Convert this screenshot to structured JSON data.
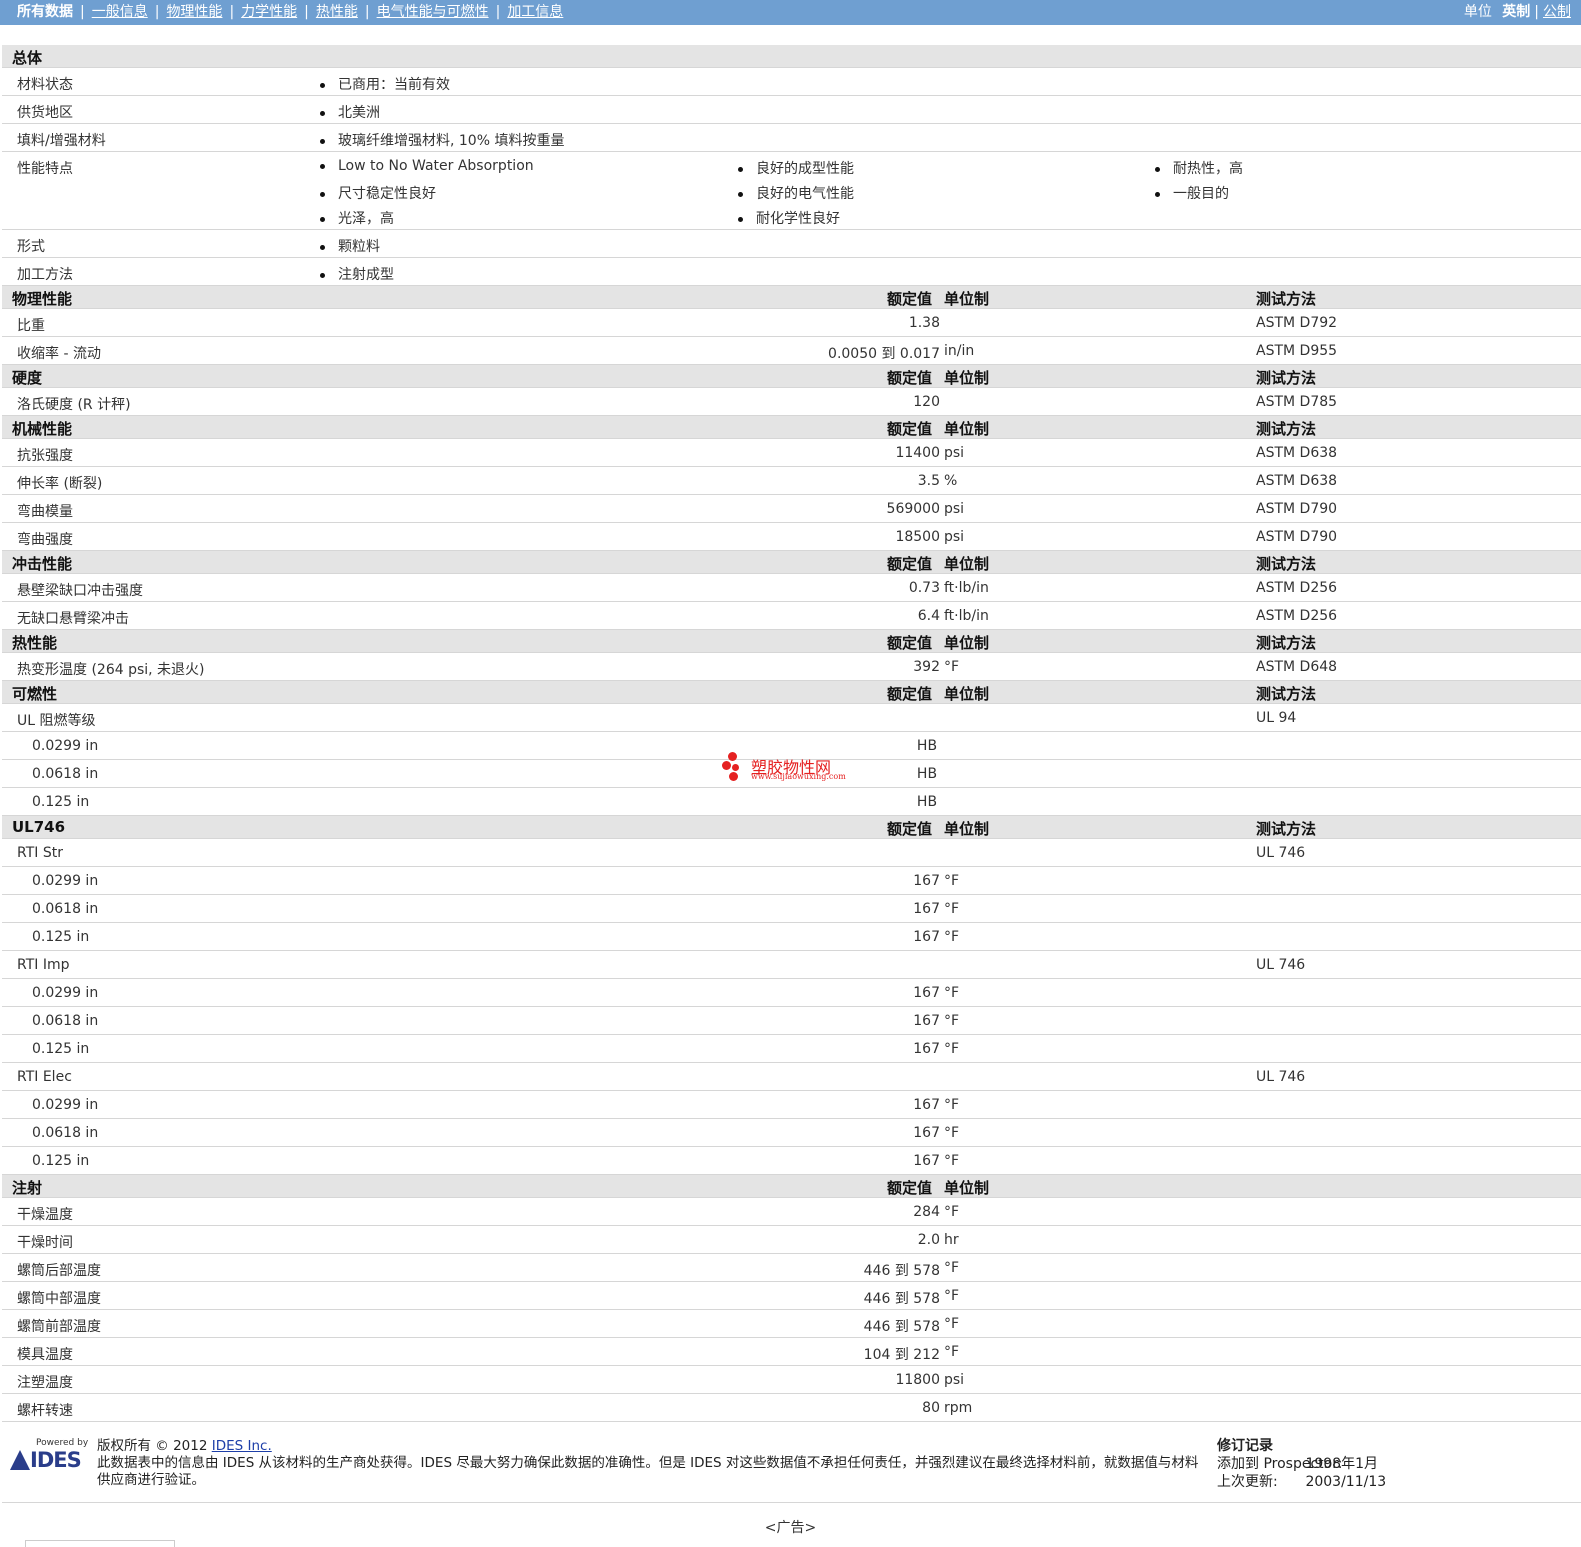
{
  "topnav": {
    "tabs": [
      "所有数据",
      "一般信息",
      "物理性能",
      "力学性能",
      "热性能",
      "电气性能与可燃性",
      "加工信息"
    ],
    "unit_label": "单位",
    "unit_imperial": "英制",
    "unit_metric": "公制"
  },
  "general": {
    "title": "总体",
    "rows": [
      {
        "label": "材料状态",
        "items": [
          "已商用：当前有效"
        ]
      },
      {
        "label": "供货地区",
        "items": [
          "北美洲"
        ]
      },
      {
        "label": "填料/增强材料",
        "items": [
          "玻璃纤维增强材料, 10% 填料按重量"
        ]
      },
      {
        "label": "性能特点",
        "items": [
          "Low to No Water Absorption",
          "良好的成型性能",
          "耐热性，高",
          "尺寸稳定性良好",
          "良好的电气性能",
          "一般目的",
          "光泽，高",
          "耐化学性良好"
        ]
      },
      {
        "label": "形式",
        "items": [
          "颗粒料"
        ]
      },
      {
        "label": "加工方法",
        "items": [
          "注射成型"
        ]
      }
    ]
  },
  "headers": {
    "nominal": "额定值",
    "unit": "单位制",
    "test": "测试方法"
  },
  "sections": [
    {
      "title": "物理性能",
      "show_test": true,
      "rows": [
        {
          "label": "比重",
          "value": "1.38",
          "unit": "",
          "test": "ASTM D792"
        },
        {
          "label": "收缩率 - 流动",
          "value": "0.0050 到  0.017",
          "unit": "in/in",
          "test": "ASTM D955"
        }
      ]
    },
    {
      "title": "硬度",
      "show_test": true,
      "rows": [
        {
          "label": "洛氏硬度 (R 计秤)",
          "value": "120",
          "unit": "",
          "test": "ASTM D785"
        }
      ]
    },
    {
      "title": "机械性能",
      "show_test": true,
      "rows": [
        {
          "label": "抗张强度",
          "value": "11400",
          "unit": "psi",
          "test": "ASTM D638"
        },
        {
          "label": "伸长率 (断裂)",
          "value": "3.5",
          "unit": "%",
          "test": "ASTM D638"
        },
        {
          "label": "弯曲模量",
          "value": "569000",
          "unit": "psi",
          "test": "ASTM D790"
        },
        {
          "label": "弯曲强度",
          "value": "18500",
          "unit": "psi",
          "test": "ASTM D790"
        }
      ]
    },
    {
      "title": "冲击性能",
      "show_test": true,
      "rows": [
        {
          "label": "悬壁梁缺口冲击强度",
          "value": "0.73",
          "unit": "ft·lb/in",
          "test": "ASTM D256"
        },
        {
          "label": "无缺口悬臂梁冲击",
          "value": "6.4",
          "unit": "ft·lb/in",
          "test": "ASTM D256"
        }
      ]
    },
    {
      "title": "热性能",
      "show_test": true,
      "rows": [
        {
          "label": "热变形温度 (264 psi, 未退火)",
          "value": "392",
          "unit": "°F",
          "test": "ASTM D648"
        }
      ]
    },
    {
      "title": "可燃性",
      "show_test": true,
      "rows": [
        {
          "label": "UL 阻燃等级",
          "value": "",
          "unit": "",
          "test": "UL 94"
        },
        {
          "label": "0.0299 in",
          "sub": true,
          "center": true,
          "value": "HB",
          "unit": "",
          "test": ""
        },
        {
          "label": "0.0618 in",
          "sub": true,
          "center": true,
          "value": "HB",
          "unit": "",
          "test": ""
        },
        {
          "label": "0.125 in",
          "sub": true,
          "center": true,
          "value": "HB",
          "unit": "",
          "test": ""
        }
      ]
    },
    {
      "title": "UL746",
      "show_test": true,
      "rows": [
        {
          "label": "RTI Str",
          "value": "",
          "unit": "",
          "test": "UL 746"
        },
        {
          "label": "0.0299 in",
          "sub": true,
          "value": "167",
          "unit": "°F",
          "test": ""
        },
        {
          "label": "0.0618 in",
          "sub": true,
          "value": "167",
          "unit": "°F",
          "test": ""
        },
        {
          "label": "0.125 in",
          "sub": true,
          "value": "167",
          "unit": "°F",
          "test": ""
        },
        {
          "label": "RTI Imp",
          "value": "",
          "unit": "",
          "test": "UL 746"
        },
        {
          "label": "0.0299 in",
          "sub": true,
          "value": "167",
          "unit": "°F",
          "test": ""
        },
        {
          "label": "0.0618 in",
          "sub": true,
          "value": "167",
          "unit": "°F",
          "test": ""
        },
        {
          "label": "0.125 in",
          "sub": true,
          "value": "167",
          "unit": "°F",
          "test": ""
        },
        {
          "label": "RTI Elec",
          "value": "",
          "unit": "",
          "test": "UL 746"
        },
        {
          "label": "0.0299 in",
          "sub": true,
          "value": "167",
          "unit": "°F",
          "test": ""
        },
        {
          "label": "0.0618 in",
          "sub": true,
          "value": "167",
          "unit": "°F",
          "test": ""
        },
        {
          "label": "0.125 in",
          "sub": true,
          "value": "167",
          "unit": "°F",
          "test": ""
        }
      ]
    },
    {
      "title": "注射",
      "show_test": false,
      "rows": [
        {
          "label": "干燥温度",
          "value": "284",
          "unit": "°F",
          "test": ""
        },
        {
          "label": "干燥时间",
          "value": "2.0",
          "unit": "hr",
          "test": ""
        },
        {
          "label": "螺筒后部温度",
          "value": "446 到  578",
          "unit": "°F",
          "test": ""
        },
        {
          "label": "螺筒中部温度",
          "value": "446 到  578",
          "unit": "°F",
          "test": ""
        },
        {
          "label": "螺筒前部温度",
          "value": "446 到  578",
          "unit": "°F",
          "test": ""
        },
        {
          "label": "模具温度",
          "value": "104 到  212",
          "unit": "°F",
          "test": ""
        },
        {
          "label": "注塑温度",
          "value": "11800",
          "unit": "psi",
          "test": ""
        },
        {
          "label": "螺杆转速",
          "value": "80",
          "unit": "rpm",
          "test": ""
        }
      ]
    }
  ],
  "watermark": {
    "text": "塑胶物性网",
    "url": "www.sujiaowuxing.com"
  },
  "footer": {
    "powered_by": "Powered by",
    "logo": "IDES",
    "copyright_prefix": "版权所有 © 2012 ",
    "company_link": "IDES Inc.",
    "disclaimer": "此数据表中的信息由 IDES 从该材料的生产商处获得。IDES 尽最大努力确保此数据的准确性。但是 IDES 对这些数据值不承担任何责任，并强烈建议在最终选择材料前，就数据值与材料供应商进行验证。",
    "revision_title": "修订记录",
    "added_label": "添加到 Prospector:",
    "added_value": "1998年1月",
    "updated_label": "上次更新:",
    "updated_value": "2003/11/13"
  },
  "ad_label": "<广告>"
}
